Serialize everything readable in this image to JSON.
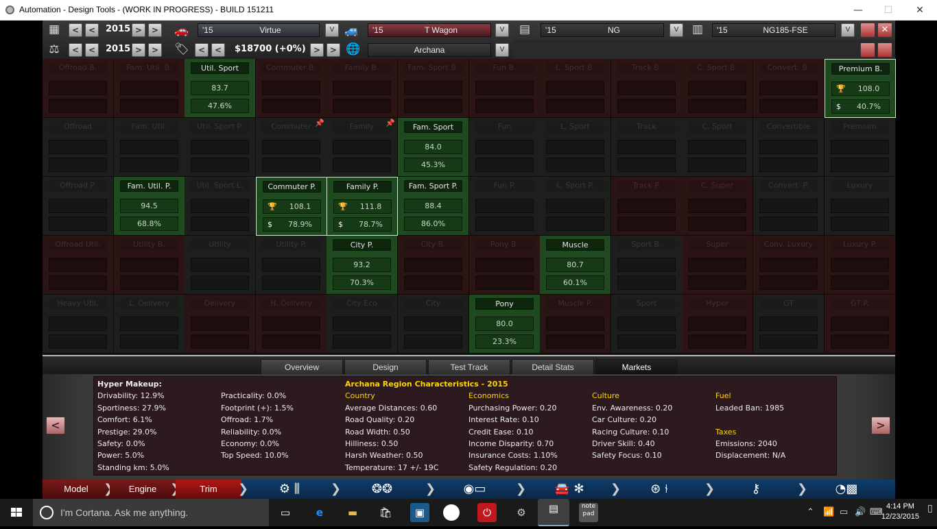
{
  "window": {
    "title": "Automation - Design Tools - (WORK IN PROGRESS) - BUILD 151211",
    "minimize": "—",
    "maximize": "☐",
    "close": "✕"
  },
  "topbar": {
    "row1_year": "2015",
    "row2_year": "2015",
    "price": "$18700 (+0%)",
    "model": {
      "year": "'15",
      "name": "Virtue"
    },
    "trim": {
      "year": "'15",
      "name": "T Wagon"
    },
    "engine_family": {
      "year": "'15",
      "name": "NG"
    },
    "engine_variant": {
      "year": "'15",
      "name": "NG185-FSE"
    },
    "region": "Archana",
    "prev": "<",
    "next": ">",
    "dropdown": "V"
  },
  "grid": {
    "rows": [
      [
        {
          "label": "Offroad B.",
          "state": "red"
        },
        {
          "label": "Fam. Util. B.",
          "state": "red"
        },
        {
          "label": "Util. Sport",
          "state": "green",
          "v1": "83.7",
          "v2": "47.6%"
        },
        {
          "label": "Commuter B.",
          "state": "red"
        },
        {
          "label": "Family B.",
          "state": "red"
        },
        {
          "label": "Fam. Sport B.",
          "state": "red"
        },
        {
          "label": "Fun B.",
          "state": "red"
        },
        {
          "label": "L. Sport B.",
          "state": "red"
        },
        {
          "label": "Track B.",
          "state": "red"
        },
        {
          "label": "C. Sport B.",
          "state": "red"
        },
        {
          "label": "Convert. B.",
          "state": "red"
        },
        {
          "label": "Premium B.",
          "state": "green",
          "sel": true,
          "v1": "108.0",
          "v2": "40.7%"
        }
      ],
      [
        {
          "label": "Offroad",
          "state": "dark"
        },
        {
          "label": "Fam. Util.",
          "state": "dark"
        },
        {
          "label": "Util. Sport P.",
          "state": "dark"
        },
        {
          "label": "Commuter",
          "state": "dark",
          "pin": true
        },
        {
          "label": "Family",
          "state": "dark",
          "pin": true
        },
        {
          "label": "Fam. Sport",
          "state": "green",
          "v1": "84.0",
          "v2": "45.3%"
        },
        {
          "label": "Fun",
          "state": "dark"
        },
        {
          "label": "L. Sport",
          "state": "dark"
        },
        {
          "label": "Track",
          "state": "dark"
        },
        {
          "label": "C. Sport",
          "state": "dark"
        },
        {
          "label": "Convertible",
          "state": "dark"
        },
        {
          "label": "Premium",
          "state": "dark"
        }
      ],
      [
        {
          "label": "Offroad P.",
          "state": "dark"
        },
        {
          "label": "Fam. Util. P.",
          "state": "green",
          "v1": "94.5",
          "v2": "68.8%"
        },
        {
          "label": "Util. Sport L.",
          "state": "dark"
        },
        {
          "label": "Commuter P.",
          "state": "green",
          "sel": true,
          "v1": "108.1",
          "v2": "78.9%"
        },
        {
          "label": "Family P.",
          "state": "green",
          "sel": true,
          "v1": "111.8",
          "v2": "78.7%"
        },
        {
          "label": "Fam. Sport P.",
          "state": "green",
          "v1": "88.4",
          "v2": "86.0%"
        },
        {
          "label": "Fun P.",
          "state": "dark"
        },
        {
          "label": "L. Sport P.",
          "state": "dark"
        },
        {
          "label": "Track P.",
          "state": "red"
        },
        {
          "label": "C. Super",
          "state": "red"
        },
        {
          "label": "Convert. P.",
          "state": "dark"
        },
        {
          "label": "Luxury",
          "state": "dark"
        }
      ],
      [
        {
          "label": "Offroad Util.",
          "state": "red"
        },
        {
          "label": "Utility B.",
          "state": "red"
        },
        {
          "label": "Utility",
          "state": "dark"
        },
        {
          "label": "Utility P.",
          "state": "dark"
        },
        {
          "label": "City P.",
          "state": "green",
          "v1": "93.2",
          "v2": "70.3%"
        },
        {
          "label": "City B.",
          "state": "red"
        },
        {
          "label": "Pony B.",
          "state": "red"
        },
        {
          "label": "Muscle",
          "state": "green",
          "v1": "80.7",
          "v2": "60.1%"
        },
        {
          "label": "Sport B.",
          "state": "dark"
        },
        {
          "label": "Super",
          "state": "red"
        },
        {
          "label": "Conv. Luxury",
          "state": "red"
        },
        {
          "label": "Luxury P.",
          "state": "red"
        }
      ],
      [
        {
          "label": "Heavy Util.",
          "state": "dark"
        },
        {
          "label": "L. Delivery",
          "state": "dark"
        },
        {
          "label": "Delivery",
          "state": "red"
        },
        {
          "label": "H. Delivery",
          "state": "red"
        },
        {
          "label": "City Eco",
          "state": "dark"
        },
        {
          "label": "City",
          "state": "dark"
        },
        {
          "label": "Pony",
          "state": "green",
          "v1": "80.0",
          "v2": "23.3%"
        },
        {
          "label": "Muscle P.",
          "state": "red"
        },
        {
          "label": "Sport",
          "state": "dark"
        },
        {
          "label": "Hyper",
          "state": "red"
        },
        {
          "label": "GT",
          "state": "dark"
        },
        {
          "label": "GT P.",
          "state": "red"
        }
      ]
    ]
  },
  "tabs": [
    "Overview",
    "Design",
    "Test Track",
    "Detail Stats",
    "Markets"
  ],
  "panel": {
    "makeup_title": "Hyper Makeup:",
    "makeup_col1": [
      "Drivability: 12.9%",
      "Sportiness: 27.9%",
      "Comfort: 6.1%",
      "Prestige: 29.0%",
      "Safety: 0.0%",
      "Power: 5.0%",
      "Standing km: 5.0%"
    ],
    "makeup_col2": [
      "Practicality: 0.0%",
      "Footprint (+): 1.5%",
      "Offroad: 1.7%",
      "Reliability: 0.0%",
      "Economy: 0.0%",
      "Top Speed: 10.0%"
    ],
    "region_title": "Archana Region Characteristics - 2015",
    "country_head": "Country",
    "country": [
      "Average Distances: 0.60",
      "Road Quality: 0.20",
      "Road Width: 0.50",
      "Hilliness: 0.50",
      "Harsh Weather: 0.50",
      "Temperature: 17 +/- 19C"
    ],
    "economics_head": "Economics",
    "economics": [
      "Purchasing Power: 0.20",
      "Interest Rate: 0.10",
      "Credit Ease: 0.10",
      "Income Disparity: 0.70",
      "Insurance Costs: 1.10%",
      "Safety Regulation: 0.20"
    ],
    "culture_head": "Culture",
    "culture": [
      "Env. Awareness: 0.20",
      "Car Culture: 0.20",
      "Racing Culture: 0.10",
      "Driver Skill: 0.40",
      "Safety Focus: 0.10"
    ],
    "fuel_head": "Fuel",
    "fuel": [
      "Leaded Ban: 1985"
    ],
    "taxes_head": "Taxes",
    "taxes": [
      "Emissions: 2040",
      "Displacement: N/A"
    ],
    "prev_arrow": "<",
    "next_arrow": ">"
  },
  "bottomnav": {
    "model": "Model",
    "engine": "Engine",
    "trim": "Trim"
  },
  "taskbar": {
    "cortana": "I'm Cortana. Ask me anything.",
    "time": "4:14 PM",
    "date": "12/23/2015"
  },
  "colors": {
    "green_cell": "#1f4a1f",
    "red_cell": "#2b1414",
    "accent_yellow": "#ffd700",
    "nav_blue": "#0e3c6a"
  }
}
